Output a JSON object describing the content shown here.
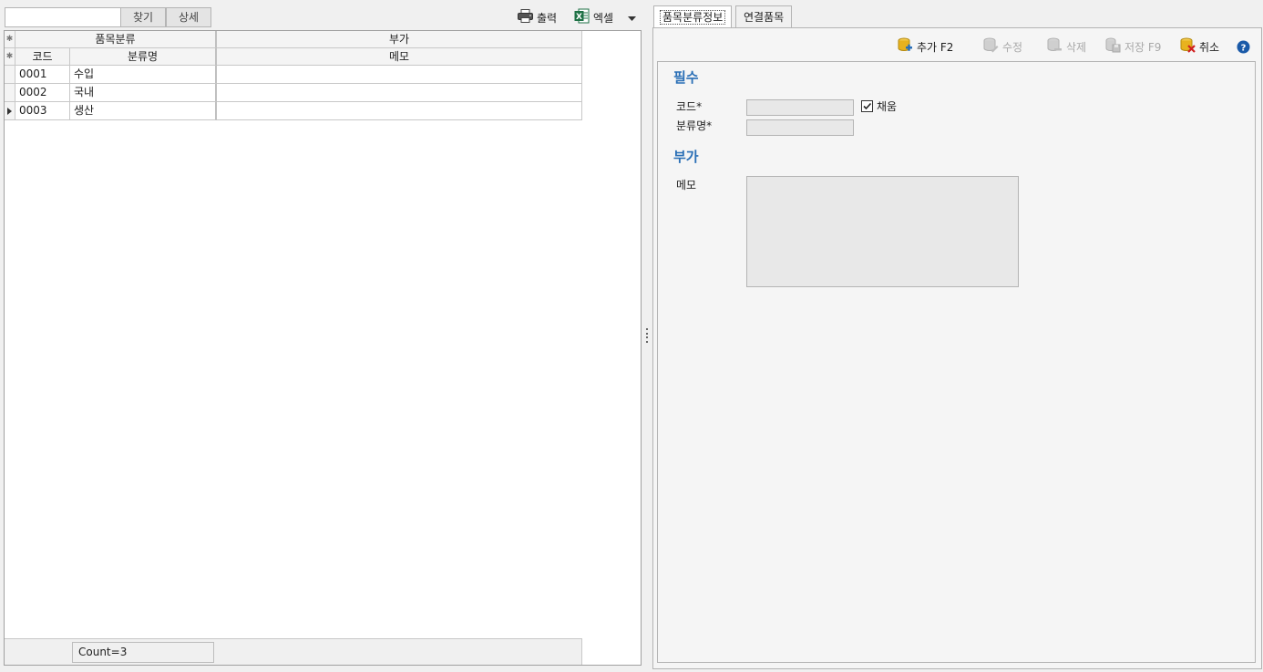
{
  "left": {
    "search": {
      "value": "",
      "placeholder": ""
    },
    "find_label": "찾기",
    "detail_label": "상세",
    "print_label": "출력",
    "excel_label": "엑셀",
    "grid": {
      "band_category": "품목분류",
      "band_extra": "부가",
      "col_code": "코드",
      "col_name": "분류명",
      "col_memo": "메모",
      "rows": [
        {
          "code": "0001",
          "name": "수입",
          "memo": ""
        },
        {
          "code": "0002",
          "name": "국내",
          "memo": ""
        },
        {
          "code": "0003",
          "name": "생산",
          "memo": ""
        }
      ]
    },
    "count_text": "Count=3"
  },
  "right": {
    "tabs": [
      {
        "label": "품목분류정보",
        "active": true
      },
      {
        "label": "연결품목",
        "active": false
      }
    ],
    "actions": {
      "add": "추가 F2",
      "edit": "수정",
      "delete": "삭제",
      "save": "저장 F9",
      "cancel": "취소",
      "help": "?"
    },
    "form": {
      "section_required": "필수",
      "code_label": "코드*",
      "name_label": "분류명*",
      "code_value": "",
      "name_value": "",
      "auto_fill_label": "채움",
      "auto_fill_checked": true,
      "section_extra": "부가",
      "memo_label": "메모",
      "memo_value": ""
    }
  },
  "colors": {
    "accent_blue": "#2a6fb6",
    "excel_green": "#1e7145",
    "db_yellow": "#e8b21e",
    "disabled_gray": "#a8a8a8"
  }
}
